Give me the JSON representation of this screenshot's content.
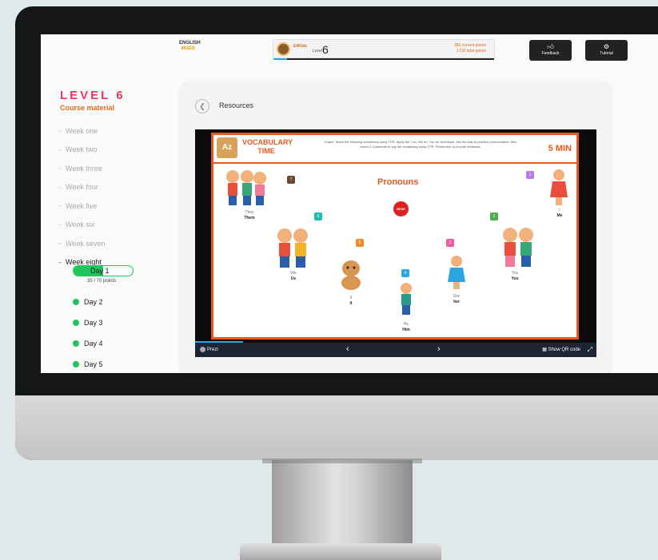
{
  "header": {
    "logo_line1": "ENGLISH",
    "logo_line2": "4KIDS",
    "user_name": "E4Kids",
    "level_label": "Level",
    "level_value": "6",
    "current_points": "355 current points",
    "total_points": "1720 total points",
    "feedback_label": "Feedback",
    "tutorial_label": "Tutorial"
  },
  "sidebar": {
    "title": "LEVEL 6",
    "subtitle": "Course material",
    "weeks": [
      "Week one",
      "Week two",
      "Week three",
      "Week four",
      "Week five",
      "Week six",
      "Week seven",
      "Week eight"
    ],
    "days": [
      "Day 1",
      "Day 2",
      "Day 3",
      "Day 4",
      "Day 5"
    ],
    "day1_points": "35 / 70 points",
    "day1_progress": 0.5
  },
  "main": {
    "back_icon": "chevron-left-icon",
    "title": "Resources"
  },
  "slide": {
    "logo": "Az",
    "heading": "VOCABULARY TIME",
    "coach_text": "Coach: Teach the following vocabulary using TPR. Apply the 'I do, We do, You do' technique. Ask the kids to practice pronunciation, then select 2-4 students to say the vocabulary using TPR. Remember to provide feedback.",
    "duration": "5 MIN",
    "topic": "Pronouns",
    "badge": "NEW!",
    "items": [
      {
        "num": "7",
        "l1": "They",
        "l2": "Them",
        "color": "#6b4a2b"
      },
      {
        "num": "6",
        "l1": "We",
        "l2": "Us",
        "color": "#21bdb0"
      },
      {
        "num": "5",
        "l1": "It",
        "l2": "It",
        "color": "#f08a24"
      },
      {
        "num": "4",
        "l1": "He",
        "l2": "Him",
        "color": "#2aa6e0"
      },
      {
        "num": "3",
        "l1": "She",
        "l2": "her",
        "color": "#f05aa3"
      },
      {
        "num": "2",
        "l1": "You",
        "l2": "You",
        "color": "#4cae4c"
      },
      {
        "num": "1",
        "l1": "I",
        "l2": "Me",
        "color": "#b57ce6"
      }
    ]
  },
  "prezi_bar": {
    "brand": "Prezi",
    "qr_label": "Show QR code",
    "progress": 0.12
  }
}
